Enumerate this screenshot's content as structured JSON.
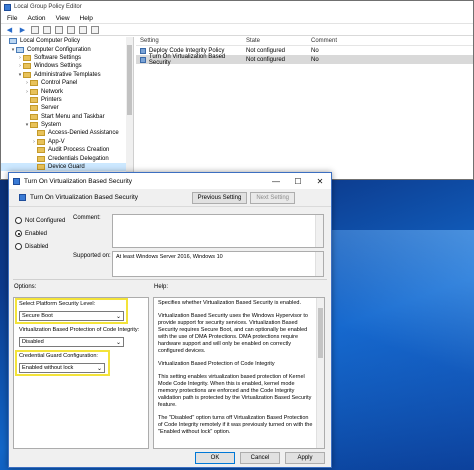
{
  "gpe": {
    "title": "Local Group Policy Editor",
    "menu": [
      "File",
      "Action",
      "View",
      "Help"
    ],
    "tree": [
      {
        "label": "Local Computer Policy",
        "indent": 0,
        "kind": "pc",
        "caret": ""
      },
      {
        "label": "Computer Configuration",
        "indent": 1,
        "kind": "pc",
        "caret": "▾"
      },
      {
        "label": "Software Settings",
        "indent": 2,
        "kind": "folder",
        "caret": "›"
      },
      {
        "label": "Windows Settings",
        "indent": 2,
        "kind": "folder",
        "caret": "›"
      },
      {
        "label": "Administrative Templates",
        "indent": 2,
        "kind": "folder",
        "caret": "▾"
      },
      {
        "label": "Control Panel",
        "indent": 3,
        "kind": "folder",
        "caret": "›"
      },
      {
        "label": "Network",
        "indent": 3,
        "kind": "folder",
        "caret": "›"
      },
      {
        "label": "Printers",
        "indent": 3,
        "kind": "folder",
        "caret": ""
      },
      {
        "label": "Server",
        "indent": 3,
        "kind": "folder",
        "caret": ""
      },
      {
        "label": "Start Menu and Taskbar",
        "indent": 3,
        "kind": "folder",
        "caret": ""
      },
      {
        "label": "System",
        "indent": 3,
        "kind": "folder",
        "caret": "▾"
      },
      {
        "label": "Access-Denied Assistance",
        "indent": 4,
        "kind": "folder",
        "caret": ""
      },
      {
        "label": "App-V",
        "indent": 4,
        "kind": "folder",
        "caret": "›"
      },
      {
        "label": "Audit Process Creation",
        "indent": 4,
        "kind": "folder",
        "caret": ""
      },
      {
        "label": "Credentials Delegation",
        "indent": 4,
        "kind": "folder",
        "caret": ""
      },
      {
        "label": "Device Guard",
        "indent": 4,
        "kind": "folder",
        "caret": "",
        "selected": true
      }
    ],
    "columns": {
      "setting": "Setting",
      "state": "State",
      "comment": "Comment"
    },
    "rows": [
      {
        "setting": "Deploy Code Integrity Policy",
        "state": "Not configured",
        "comment": "No"
      },
      {
        "setting": "Turn On Virtualization Based Security",
        "state": "Not configured",
        "comment": "No",
        "selected": true
      }
    ]
  },
  "dialog": {
    "title": "Turn On Virtualization Based Security",
    "sub_title": "Turn On Virtualization Based Security",
    "prev_button": "Previous Setting",
    "next_button": "Next Setting",
    "radios": {
      "not_configured": "Not Configured",
      "enabled": "Enabled",
      "disabled": "Disabled"
    },
    "comment_label": "Comment:",
    "supported_label": "Supported on:",
    "supported_value": "At least Windows Server 2016, Windows 10",
    "options_label": "Options:",
    "help_label": "Help:",
    "platform_label": "Select Platform Security Level:",
    "platform_value": "Secure Boot",
    "vbp_label": "Virtualization Based Protection of Code Integrity:",
    "vbp_value": "Disabled",
    "cg_label": "Credential Guard Configuration:",
    "cg_value": "Enabled without lock",
    "help": [
      "Specifies whether Virtualization Based Security is enabled.",
      "Virtualization Based Security uses the Windows Hypervisor to provide support for security services. Virtualization Based Security requires Secure Boot, and can optionally be enabled with the use of DMA Protections. DMA protections require hardware support and will only be enabled on correctly configured devices.",
      "Virtualization Based Protection of Code Integrity",
      "This setting enables virtualization based protection of Kernel Mode Code Integrity. When this is enabled, kernel mode memory protections are enforced and the Code Integrity validation path is protected by the Virtualization Based Security feature.",
      "The \"Disabled\" option turns off Virtualization Based Protection of Code Integrity remotely if it was previously turned on with the \"Enabled without lock\" option."
    ],
    "ok": "OK",
    "cancel": "Cancel",
    "apply": "Apply"
  },
  "colors": {
    "highlight": "#f3e33a",
    "selection": "#cce8ff",
    "accent": "#0078d7"
  }
}
